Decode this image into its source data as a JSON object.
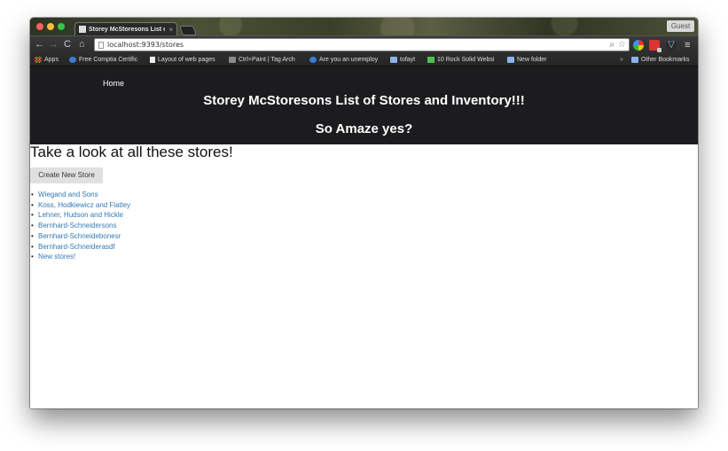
{
  "browser": {
    "tab_title": "Storey McStoresons List of Stores and Inventory!!!",
    "tab_close": "×",
    "guest_label": "Guest",
    "url": "localhost:9393/stores",
    "nav": {
      "back": "←",
      "forward": "→",
      "reload": "C",
      "home": "⌂"
    },
    "menu": "≡",
    "search_icon": "⌕",
    "star_icon": "☆",
    "diamond_icon": "▽",
    "bookmarks": {
      "items": [
        "Apps",
        "Free Comptia Certific",
        "Layout of web pages",
        "Ctrl+Paint | Tag Arch",
        "Are you an unemploy",
        "tofayt",
        "10 Rock Solid Websi",
        "New folder"
      ],
      "more": "»",
      "other": "Other Bookmarks"
    }
  },
  "site": {
    "nav_home": "Home",
    "title": "Storey McStoresons List of Stores and Inventory!!!",
    "subtitle": "So Amaze yes?",
    "heading": "Take a look at all these stores!",
    "create_button": "Create New Store",
    "stores": [
      "Wiegand and Sons",
      "Koss, Hodkiewicz and Flatley",
      "Lehner, Hudson and Hickle",
      "Bernhard-Schneidersons",
      "Bernhard-Schneidebonesr",
      "Bernhard-Schneiderasdf",
      "New stores!"
    ]
  },
  "colors": {
    "header_bg": "#1c1c1e",
    "link": "#337ab7",
    "button_bg": "#e0e0e0"
  }
}
